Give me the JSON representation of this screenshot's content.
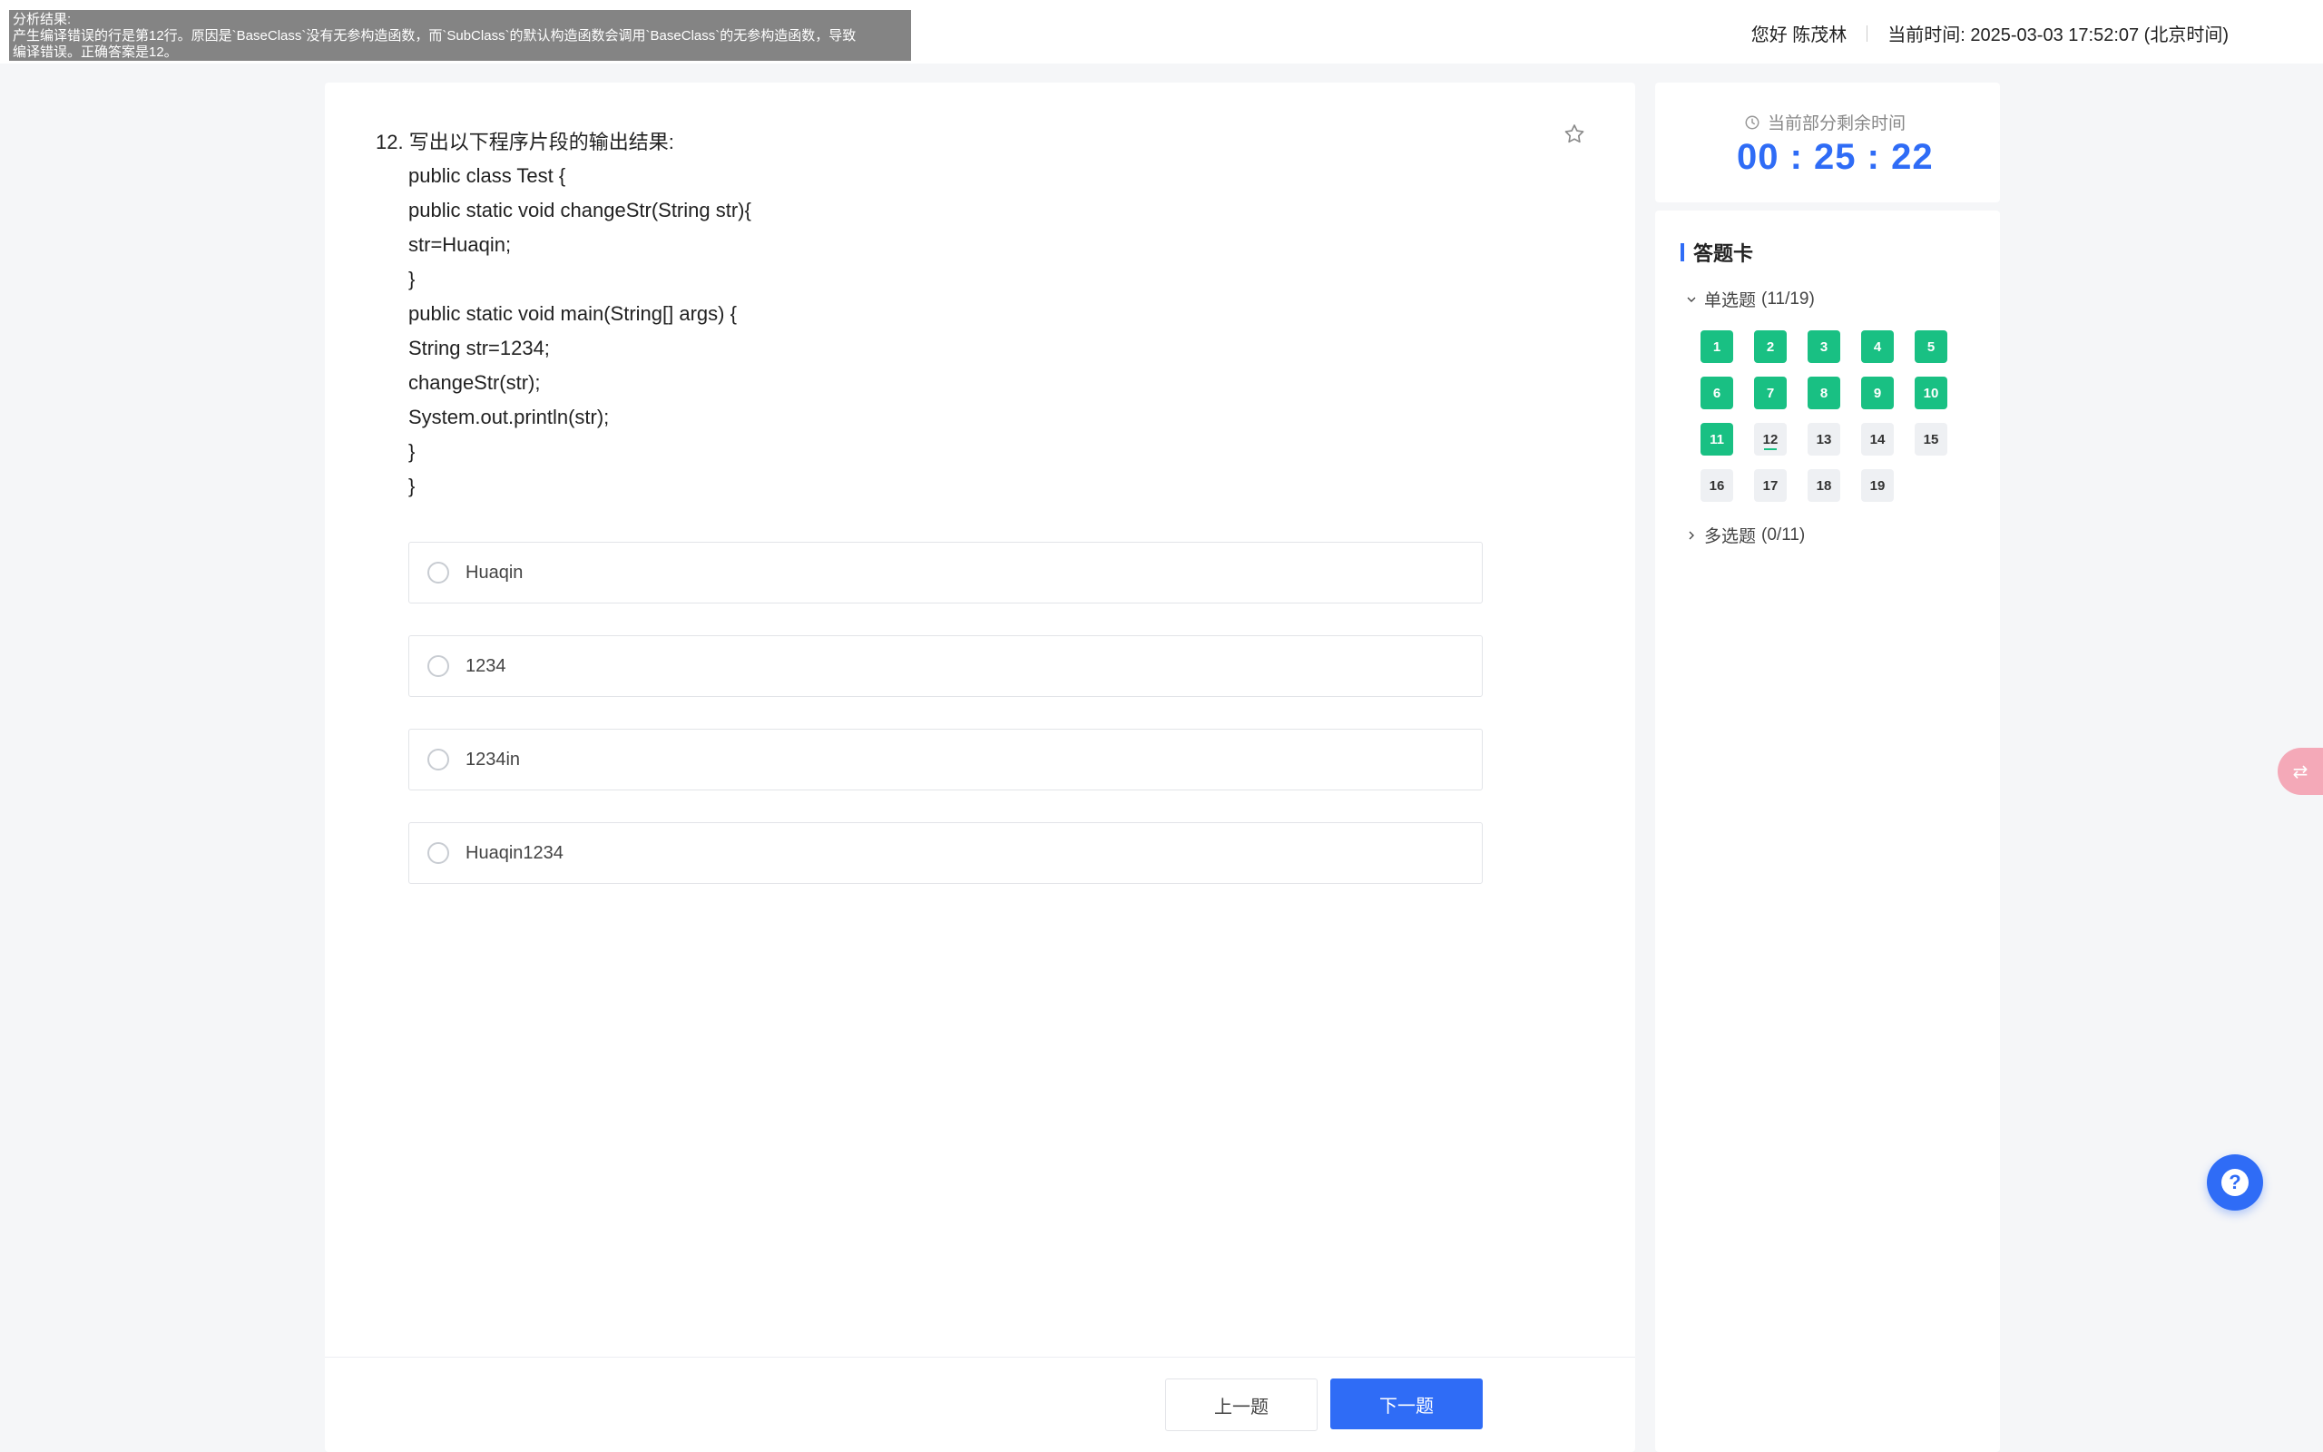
{
  "overlay": {
    "line1": "分析结果:",
    "line2": "产生编译错误的行是第12行。原因是`BaseClass`没有无参构造函数，而`SubClass`的默认构造函数会调用`BaseClass`的无参构造函数，导致",
    "line3": "编译错误。正确答案是12。"
  },
  "header": {
    "greeting": "您好 陈茂林",
    "time_label": "当前时间:",
    "time_value": "2025-03-03 17:52:07 (北京时间)"
  },
  "question": {
    "title": "12. 写出以下程序片段的输出结果:",
    "code": [
      "public class Test {",
      "public static void changeStr(String str){",
      "str=Huaqin;",
      "}",
      "public static void main(String[] args) {",
      "String str=1234;",
      "changeStr(str);",
      "System.out.println(str);",
      "}",
      "}"
    ],
    "options": [
      "Huaqin",
      "1234",
      "1234in",
      "Huaqin1234"
    ]
  },
  "nav": {
    "prev": "上一题",
    "next": "下一题"
  },
  "timer": {
    "label": "当前部分剩余时间",
    "value": "00 : 25 : 22"
  },
  "answer_card": {
    "title": "答题卡",
    "single": {
      "label": "单选题",
      "count": "(11/19)"
    },
    "numbers": [
      "1",
      "2",
      "3",
      "4",
      "5",
      "6",
      "7",
      "8",
      "9",
      "10",
      "11",
      "12",
      "13",
      "14",
      "15",
      "16",
      "17",
      "18",
      "19"
    ],
    "answered_up_to": 11,
    "current": 12,
    "multi": {
      "label": "多选题",
      "count": "(0/11)"
    }
  },
  "colors": {
    "accent": "#2f6cf6",
    "done": "#19c083"
  }
}
